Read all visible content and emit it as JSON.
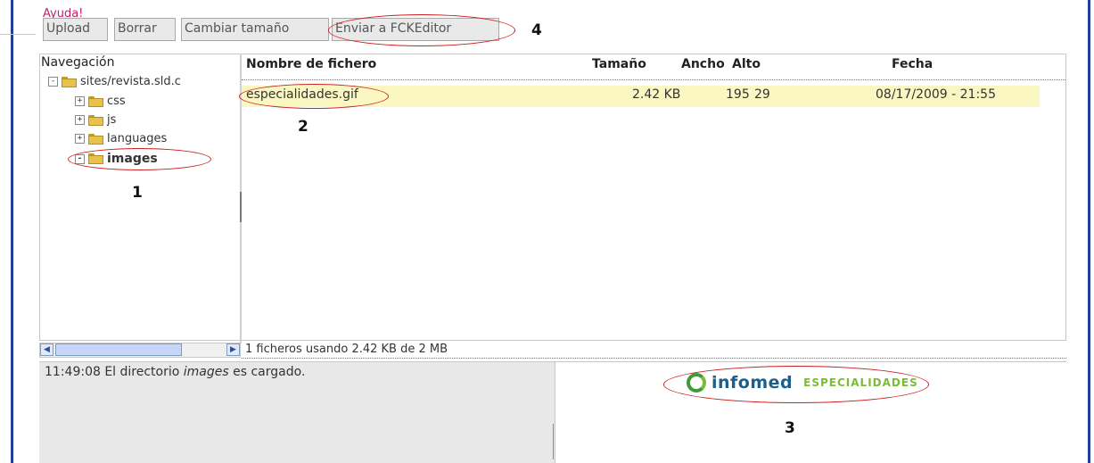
{
  "toolbar": {
    "help": "Ayuda!",
    "upload": "Upload",
    "delete": "Borrar",
    "resize": "Cambiar tamaño",
    "send": "Enviar a FCKEditor"
  },
  "nav": {
    "title": "Navegación",
    "root": "sites/revista.sld.c",
    "folders": [
      {
        "expander": "+",
        "label": "css"
      },
      {
        "expander": "+",
        "label": "js"
      },
      {
        "expander": "+",
        "label": "languages"
      },
      {
        "expander": "-",
        "label": "images"
      }
    ]
  },
  "files": {
    "columns": {
      "name": "Nombre de fichero",
      "size": "Tamaño",
      "width": "Ancho",
      "height": "Alto",
      "date": "Fecha"
    },
    "rows": [
      {
        "name": "especialidades.gif",
        "size": "2.42 KB",
        "width": "195",
        "height": "29",
        "date": "08/17/2009 - 21:55"
      }
    ]
  },
  "status": "1 ficheros usando 2.42 KB de 2 MB",
  "log": {
    "prefix": "11:49:08 El directorio ",
    "folder": "images",
    "suffix": " es cargado."
  },
  "preview": {
    "logo_main": "infomed",
    "logo_sub": "ESPECIALIDADES"
  },
  "annotations": {
    "one": "1",
    "two": "2",
    "three": "3",
    "four": "4"
  },
  "colors": {
    "highlight_row": "#fbf7c2",
    "annotation_circle": "#cc1f1f",
    "help_link": "#c0226a"
  }
}
